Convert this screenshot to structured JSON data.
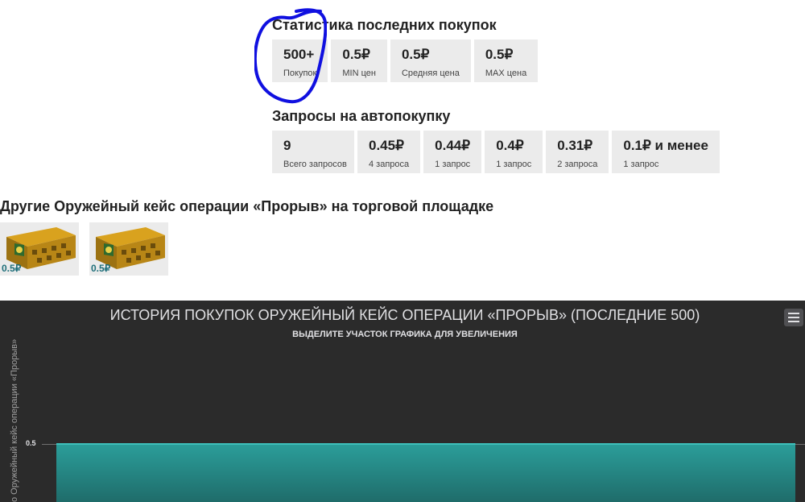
{
  "purchase_stats": {
    "title": "Статистика последних покупок",
    "items": [
      {
        "value": "500+",
        "label": "Покупок"
      },
      {
        "value": "0.5₽",
        "label": "MIN цен"
      },
      {
        "value": "0.5₽",
        "label": "Средняя цена"
      },
      {
        "value": "0.5₽",
        "label": "MAX цена"
      }
    ]
  },
  "autobuy": {
    "title": "Запросы на автопокупку",
    "items": [
      {
        "value": "9",
        "label": "Всего запросов"
      },
      {
        "value": "0.45₽",
        "label": "4 запроса"
      },
      {
        "value": "0.44₽",
        "label": "1 запрос"
      },
      {
        "value": "0.4₽",
        "label": "1 запрос"
      },
      {
        "value": "0.31₽",
        "label": "2 запроса"
      },
      {
        "value": "0.1₽ и менее",
        "label": "1 запрос"
      }
    ]
  },
  "other": {
    "title": "Другие Оружейный кейс операции «Прорыв» на торговой площадке",
    "items": [
      {
        "price": "0.5₽"
      },
      {
        "price": "0.5₽"
      }
    ]
  },
  "chart": {
    "title": "ИСТОРИЯ ПОКУПОК ОРУЖЕЙНЫЙ КЕЙС ОПЕРАЦИИ «ПРОРЫВ» (ПОСЛЕДНИЕ 500)",
    "subtitle": "ВЫДЕЛИТЕ УЧАСТОК ГРАФИКА ДЛЯ УВЕЛИЧЕНИЯ",
    "ylabel": "о Оружейный кейс операции «Прорыв»",
    "ytick": "0.5"
  },
  "chart_data": {
    "type": "area",
    "title": "ИСТОРИЯ ПОКУПОК ОРУЖЕЙНЫЙ КЕЙС ОПЕРАЦИИ «ПРОРЫВ» (ПОСЛЕДНИЕ 500)",
    "ylabel": "о Оружейный кейс операции «Прорыв»",
    "y_ticks": [
      0.5
    ],
    "series": [
      {
        "values": [
          0.5,
          0.5
        ]
      }
    ]
  },
  "colors": {
    "accent": "#2b9e9a",
    "chart_bg": "#2b2b2b",
    "price_text": "#1f6f7a",
    "annotation": "#1010e0"
  }
}
